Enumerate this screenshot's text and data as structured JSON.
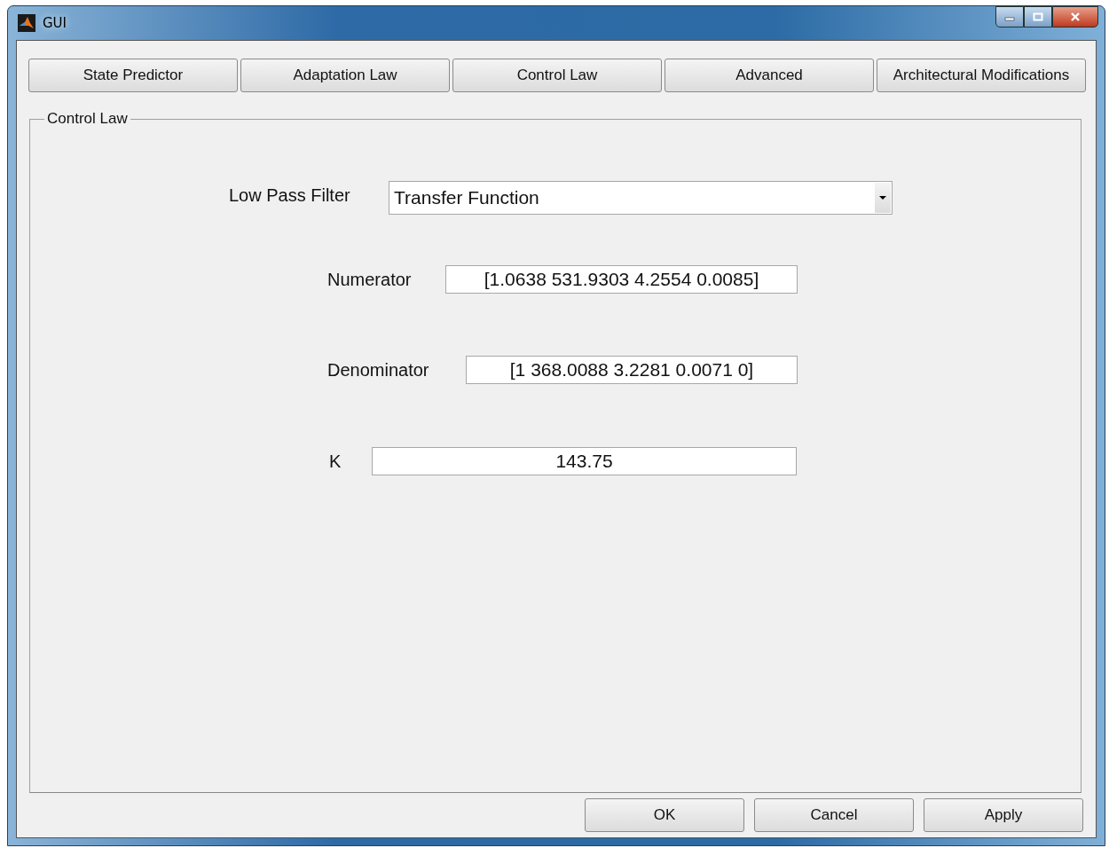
{
  "window": {
    "title": "GUI"
  },
  "tabs": [
    {
      "label": "State Predictor"
    },
    {
      "label": "Adaptation Law"
    },
    {
      "label": "Control Law"
    },
    {
      "label": "Advanced"
    },
    {
      "label": "Architectural Modifications"
    }
  ],
  "panel": {
    "title": "Control Law",
    "fields": [
      {
        "kind": "dropdown",
        "label": "Low Pass Filter",
        "value": "Transfer Function"
      },
      {
        "kind": "text",
        "label": "Numerator",
        "value": "[1.0638 531.9303 4.2554 0.0085]"
      },
      {
        "kind": "text",
        "label": "Denominator",
        "value": "[1 368.0088 3.2281 0.0071 0]"
      },
      {
        "kind": "text",
        "label": "K",
        "value": "143.75"
      }
    ]
  },
  "buttons": [
    "OK",
    "Cancel",
    "Apply"
  ]
}
